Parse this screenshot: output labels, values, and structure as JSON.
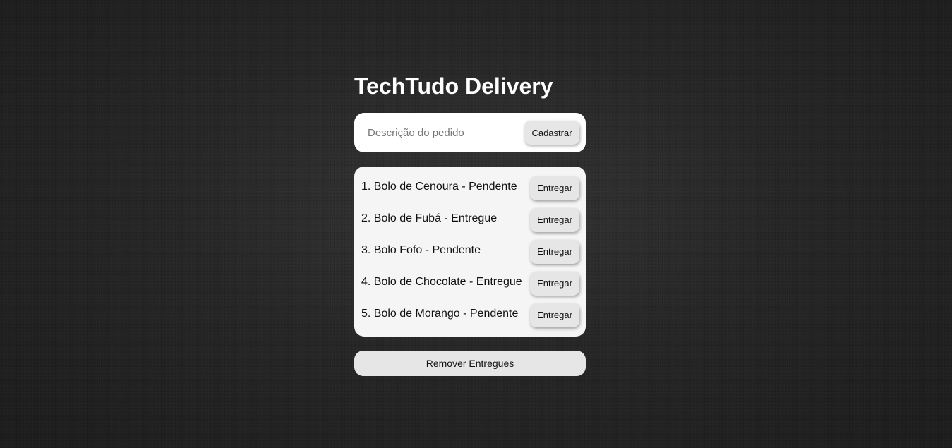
{
  "app": {
    "title": "TechTudo Delivery"
  },
  "form": {
    "placeholder": "Descrição do pedido",
    "value": "",
    "submit_label": "Cadastrar"
  },
  "orders": [
    {
      "text": "1. Bolo de Cenoura - Pendente",
      "action_label": "Entregar"
    },
    {
      "text": "2. Bolo de Fubá - Entregue",
      "action_label": "Entregar"
    },
    {
      "text": "3. Bolo Fofo - Pendente",
      "action_label": "Entregar"
    },
    {
      "text": "4. Bolo de Chocolate - Entregue",
      "action_label": "Entregar"
    },
    {
      "text": "5. Bolo de Morango - Pendente",
      "action_label": "Entregar"
    }
  ],
  "footer": {
    "remove_label": "Remover Entregues"
  },
  "colors": {
    "background": "#262626",
    "card": "#ffffff",
    "list_card": "#f5f5f5",
    "button": "#e6e6e6",
    "title_text": "#ffffff"
  }
}
